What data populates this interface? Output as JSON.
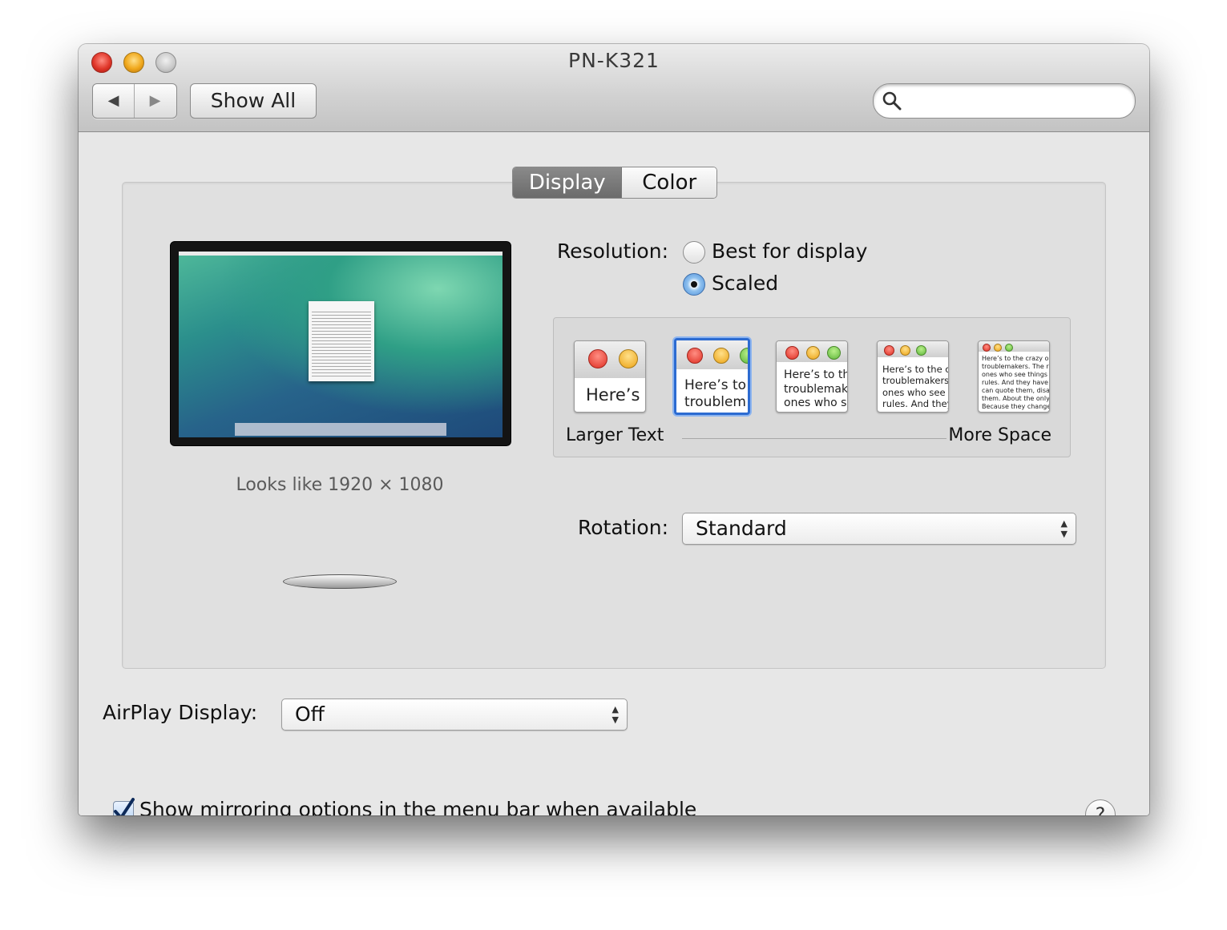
{
  "window": {
    "title": "PN-K321"
  },
  "toolbar": {
    "back_icon": "◀",
    "forward_icon": "▶",
    "show_all_label": "Show All",
    "search": {
      "value": "",
      "placeholder": ""
    }
  },
  "tabs": [
    {
      "label": "Display",
      "selected": true
    },
    {
      "label": "Color",
      "selected": false
    }
  ],
  "display_preview": {
    "looks_like": "Looks like 1920 × 1080"
  },
  "resolution": {
    "label": "Resolution:",
    "options": [
      {
        "label": "Best for display",
        "selected": false
      },
      {
        "label": "Scaled",
        "selected": true
      }
    ]
  },
  "scaled_options": {
    "thumbnails": [
      {
        "text": "Here’s",
        "selected": false
      },
      {
        "text": "Here’s to\ntroublem",
        "selected": true
      },
      {
        "text": "Here’s to th\ntroublemak\nones who s",
        "selected": false
      },
      {
        "text": "Here’s to the cr\ntroublemakers.\nones who see t\nrules. And they",
        "selected": false
      },
      {
        "text": "Here’s to the crazy ones\ntroublemakers. The rou\nones who see things dif\nrules. And they have no\ncan quote them, disagre\nthem. About the only th\nBecause they change th",
        "selected": false
      }
    ],
    "left_label": "Larger Text",
    "right_label": "More Space"
  },
  "rotation": {
    "label": "Rotation:",
    "value": "Standard"
  },
  "airplay": {
    "label": "AirPlay Display:",
    "value": "Off"
  },
  "mirroring": {
    "label": "Show mirroring options in the menu bar when available",
    "checked": true
  },
  "help": {
    "label": "?"
  },
  "colors": {
    "selection_blue": "#2c6bd1",
    "tab_selected": "#6b6b6b"
  }
}
